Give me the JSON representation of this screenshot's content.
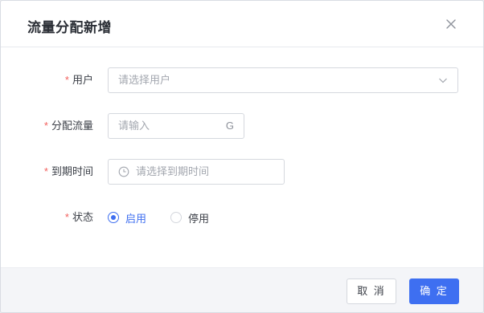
{
  "dialog": {
    "title": "流量分配新增",
    "close_icon": "close-icon"
  },
  "form": {
    "required_mark": "*",
    "user": {
      "label": "用户",
      "placeholder": "请选择用户",
      "icon": "chevron-down-icon"
    },
    "traffic": {
      "label": "分配流量",
      "placeholder": "请输入",
      "suffix": "G"
    },
    "expire": {
      "label": "到期时间",
      "placeholder": "请选择到期时间",
      "icon": "clock-icon"
    },
    "status": {
      "label": "状态",
      "options": [
        {
          "label": "启用",
          "selected": true
        },
        {
          "label": "停用",
          "selected": false
        }
      ]
    }
  },
  "footer": {
    "cancel_label": "取 消",
    "ok_label": "确 定"
  },
  "colors": {
    "primary": "#3e6ff1",
    "required": "#f25f5c",
    "footer_bg": "#f4f5f8"
  }
}
